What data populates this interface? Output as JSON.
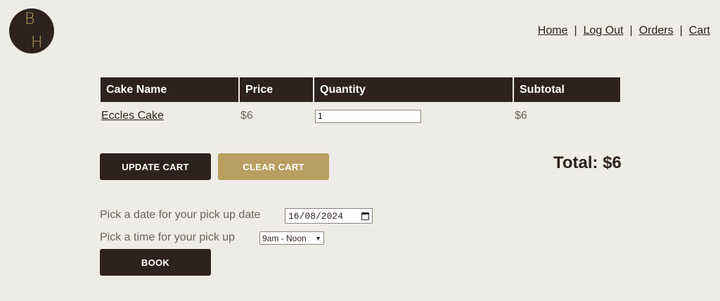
{
  "logo": {
    "line1": "B",
    "line2": "H"
  },
  "nav": {
    "home": "Home",
    "logout": "Log Out",
    "orders": "Orders",
    "cart": "Cart",
    "separator": "|"
  },
  "table": {
    "headers": [
      "Cake Name",
      "Price",
      "Quantity",
      "Subtotal"
    ],
    "rows": [
      {
        "name": "Eccles Cake",
        "price": "$6",
        "quantity": "1",
        "subtotal": "$6"
      }
    ]
  },
  "buttons": {
    "update": "UPDATE CART",
    "clear": "CLEAR CART",
    "book": "BOOK"
  },
  "total": "Total: $6",
  "pickup": {
    "date_label": "Pick a date for your pick up date",
    "date_value": "16/08/2024",
    "time_label": "Pick a time for your pick up",
    "time_value": "9am - Noon"
  },
  "colors": {
    "dark": "#2e221e",
    "gold": "#b89e60",
    "background": "#eeece7"
  }
}
